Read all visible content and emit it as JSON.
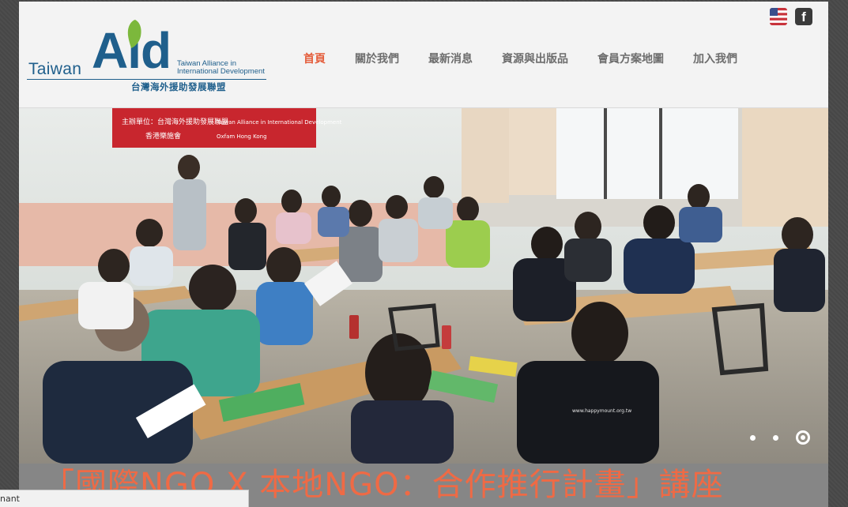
{
  "logo": {
    "small_text": "Taiwan",
    "big_text": "Aid",
    "english_name_line1": "Taiwan Alliance in",
    "english_name_line2": "International Development",
    "chinese_name": "台灣海外援助發展聯盟"
  },
  "nav": {
    "items": [
      {
        "label": "首頁",
        "active": true
      },
      {
        "label": "關於我們",
        "active": false
      },
      {
        "label": "最新消息",
        "active": false
      },
      {
        "label": "資源與出版品",
        "active": false
      },
      {
        "label": "會員方案地圖",
        "active": false
      },
      {
        "label": "加入我們",
        "active": false
      }
    ]
  },
  "social": {
    "language_icon": "us-flag-icon",
    "facebook_icon": "facebook-icon",
    "facebook_glyph": "f"
  },
  "hero": {
    "banner_line1": "主辦單位：台灣海外援助發展聯盟",
    "banner_line1_en": "Taiwan Alliance in International Development",
    "banner_line2": "香港樂施會",
    "banner_line2_en": "Oxfam Hong Kong",
    "shirt_text": "www.happymount.org.tw",
    "slide_count": 3,
    "active_slide": 3
  },
  "caption": {
    "text": "「國際NGO X 本地NGO：合作推行計畫」講座"
  },
  "statusbar": {
    "text": "nant"
  },
  "colors": {
    "brand_blue": "#1f5f8c",
    "brand_green": "#7cb83c",
    "nav_active": "#e45c3a",
    "caption": "#ef6a45"
  }
}
